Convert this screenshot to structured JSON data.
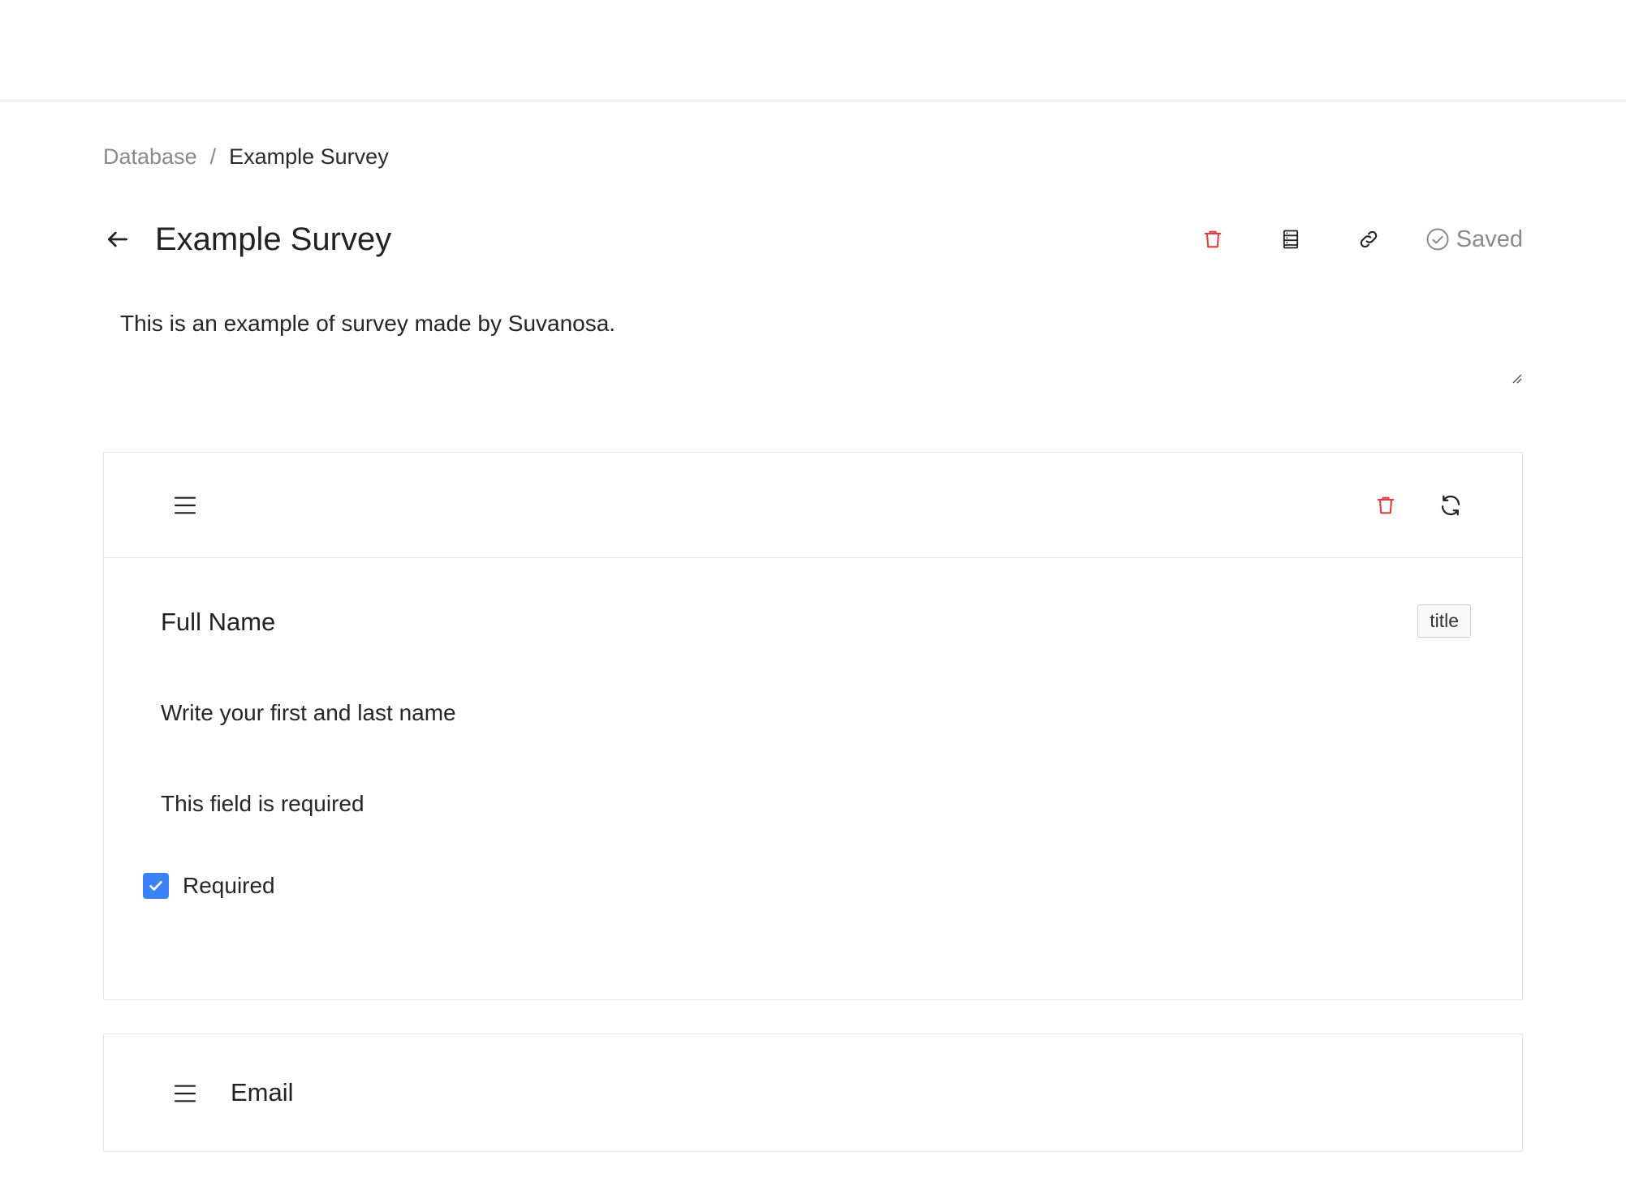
{
  "breadcrumb": {
    "parent": "Database",
    "separator": "/",
    "current": "Example Survey"
  },
  "header": {
    "title": "Example Survey",
    "status": "Saved"
  },
  "description": {
    "value": "This is an example of survey made by Suvanosa."
  },
  "questions": [
    {
      "title": "Full Name",
      "type_badge": "title",
      "help_text": "Write your first and last name",
      "error_text": "This field is required",
      "required_label": "Required",
      "required": true
    },
    {
      "title": "Email"
    }
  ],
  "icons": {
    "back": "arrow-left-icon",
    "delete": "trash-icon",
    "responses": "list-icon",
    "link": "link-icon",
    "saved": "check-circle-icon",
    "drag": "menu-icon",
    "refresh": "refresh-icon",
    "checkbox": "check-icon"
  },
  "colors": {
    "danger": "#e03e3e",
    "accent": "#3b82f6",
    "muted": "#8a8a8a"
  }
}
